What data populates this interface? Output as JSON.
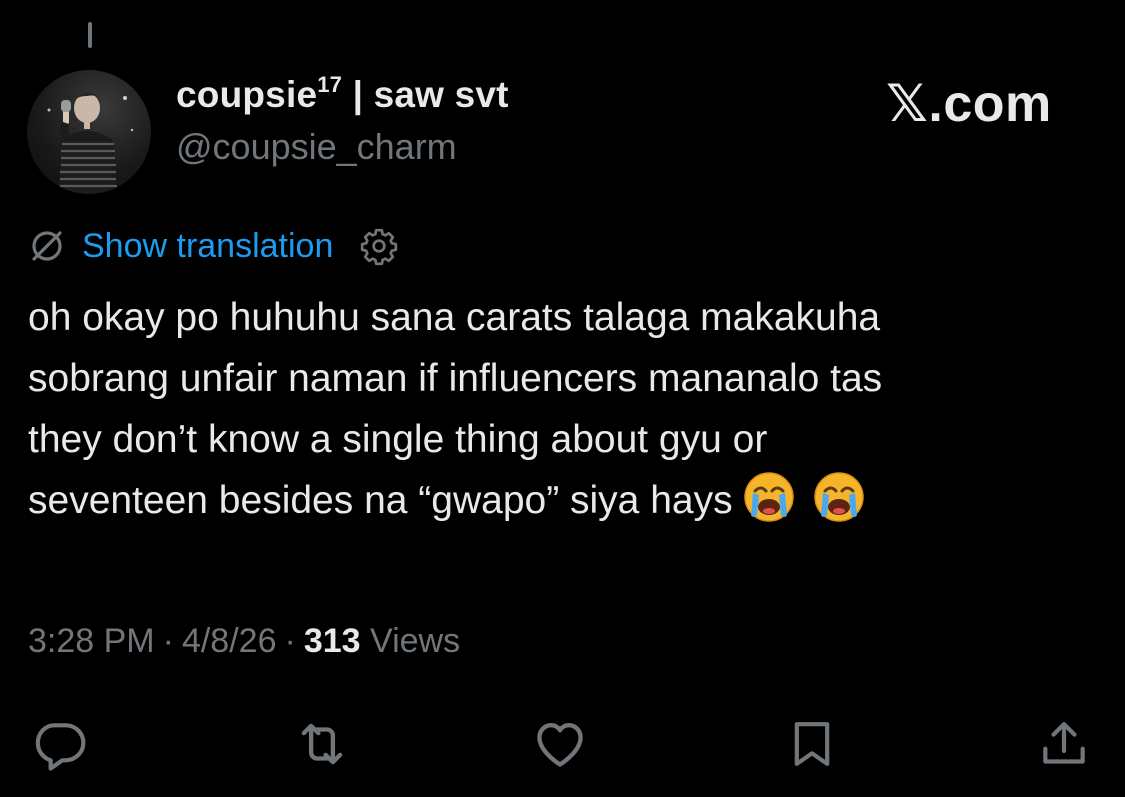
{
  "user": {
    "display_name": "coupsie",
    "superscript": "17",
    "name_suffix": " | saw svt",
    "handle": "@coupsie_charm"
  },
  "brand": {
    "label": "𝕏.com"
  },
  "translation": {
    "label": "Show translation"
  },
  "tweet": {
    "lines": [
      "oh okay po huhuhu sana carats talaga makakuha",
      "sobrang unfair naman if influencers mananalo tas",
      "they don’t know a single thing about gyu or",
      "seventeen besides na “gwapo” siya hays"
    ],
    "emoji": [
      "loudly-crying-face",
      "loudly-crying-face"
    ]
  },
  "meta": {
    "time": "3:28 PM",
    "separator": "·",
    "date": "4/8/26",
    "views_count": "313",
    "views_label": "Views"
  },
  "actions": {
    "icons": [
      "reply-icon",
      "repost-icon",
      "like-icon",
      "bookmark-icon",
      "share-icon"
    ]
  },
  "colors": {
    "background": "#000000",
    "primary_text": "#e7e9ea",
    "secondary_text": "#71767b",
    "link": "#1d9bf0"
  }
}
